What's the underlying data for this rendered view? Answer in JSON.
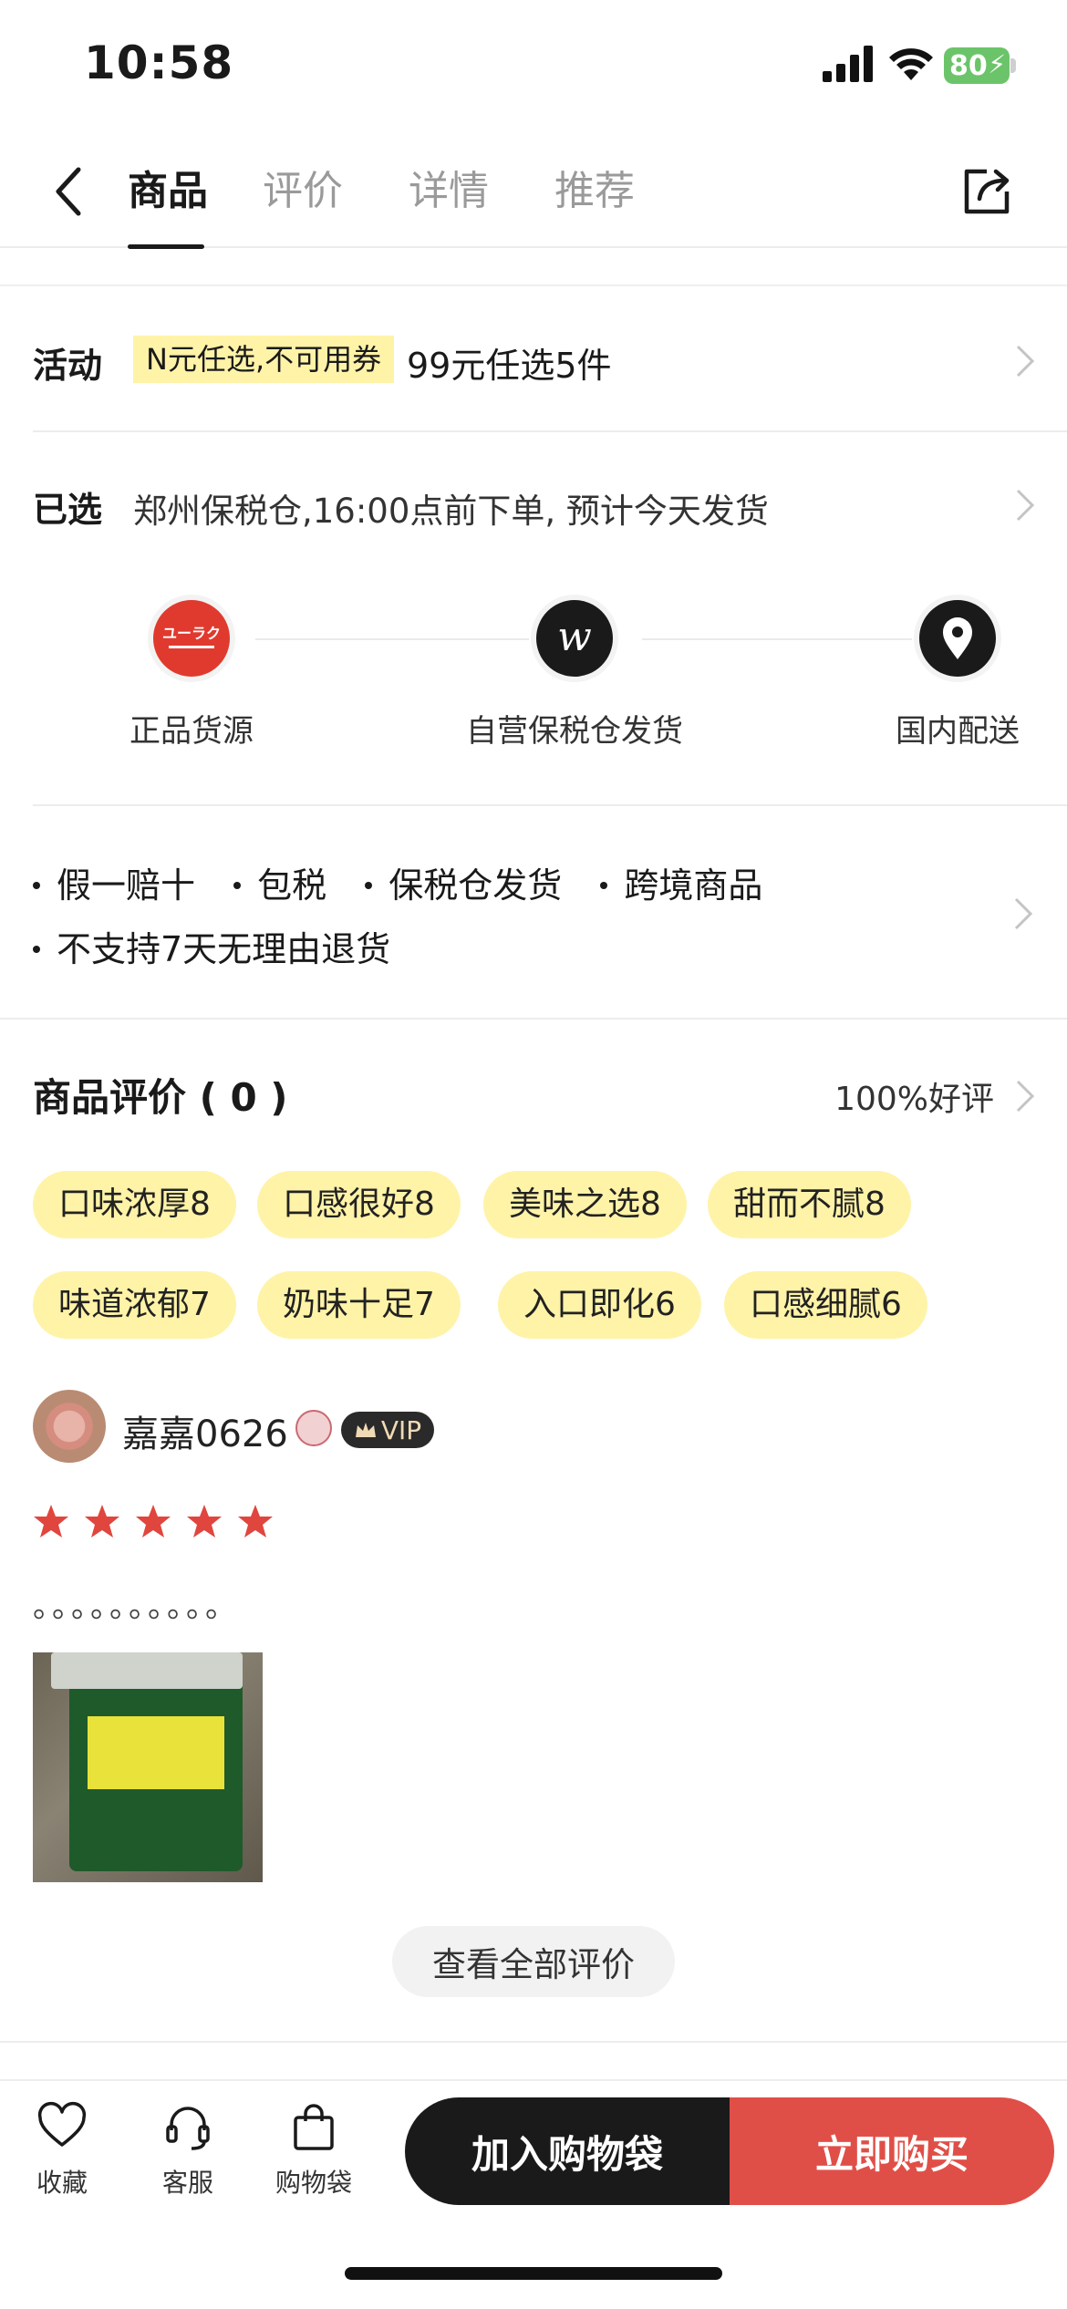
{
  "status_bar": {
    "time": "10:58",
    "battery": "80"
  },
  "header": {
    "tabs": [
      {
        "label": "商品",
        "active": true
      },
      {
        "label": "评价",
        "active": false
      },
      {
        "label": "详情",
        "active": false
      },
      {
        "label": "推荐",
        "active": false
      }
    ]
  },
  "promo": {
    "label": "活动",
    "tag": "N元任选,不可用券",
    "text": "99元任选5件"
  },
  "selected": {
    "label": "已选",
    "text": "郑州保税仓,16:00点前下单, 预计今天发货"
  },
  "features": [
    {
      "label": "正品货源",
      "icon": "brand-logo-icon",
      "color": "#e03a2f"
    },
    {
      "label": "自营保税仓发货",
      "icon": "w-logo-icon",
      "color": "#1a1a1a"
    },
    {
      "label": "国内配送",
      "icon": "location-pin-icon",
      "color": "#1a1a1a"
    }
  ],
  "guarantees": {
    "line1": [
      "假一赔十",
      "包税",
      "保税仓发货",
      "跨境商品"
    ],
    "line2": [
      "不支持7天无理由退货"
    ]
  },
  "reviews": {
    "title": "商品评价 ( 0 )",
    "positive_rate": "100%好评",
    "tags": [
      "口味浓厚8",
      "口感很好8",
      "美味之选8",
      "甜而不腻8",
      "味道浓郁7",
      "奶味十足7",
      "入口即化6",
      "口感细腻6"
    ],
    "first_review": {
      "username": "嘉嘉0626",
      "vip": "VIP",
      "rating": 5,
      "text": "。。。。。。。。。。"
    },
    "all_button": "查看全部评价"
  },
  "bottom_bar": {
    "favorite": "收藏",
    "service": "客服",
    "bag": "购物袋",
    "add_to_bag": "加入购物袋",
    "buy_now": "立即购买"
  },
  "colors": {
    "accent_red": "#e04f47",
    "tag_yellow": "#fff3a8"
  }
}
